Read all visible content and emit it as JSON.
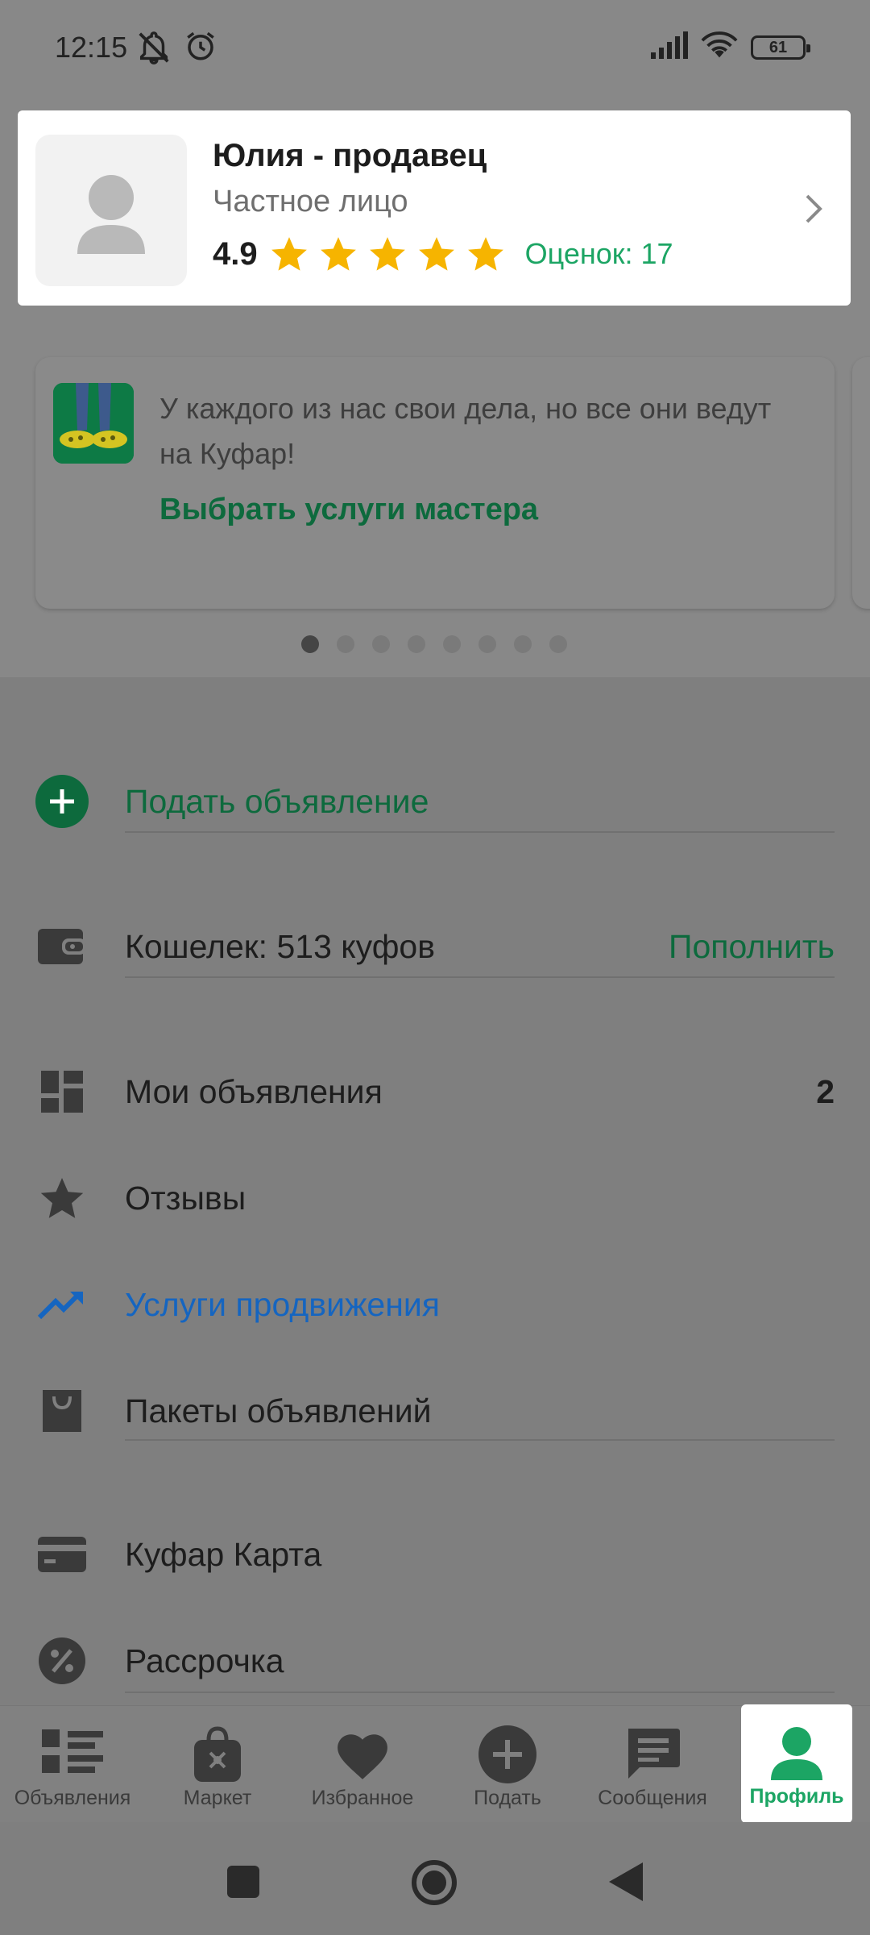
{
  "status_bar": {
    "time": "12:15",
    "battery": "61",
    "icons": [
      "notifications-off-icon",
      "alarm-icon",
      "signal-icon",
      "wifi-icon",
      "battery-icon"
    ]
  },
  "profile": {
    "name": "Юлия - продавец",
    "type": "Частное лицо",
    "rating": "4.9",
    "stars": 5,
    "ratings_count": "Оценок: 17"
  },
  "promo": {
    "text": "У каждого из нас свои дела, но все они ведут на Куфар!",
    "link": "Выбрать услуги мастера",
    "pages": 8,
    "active_page": 1
  },
  "menu": {
    "post_ad": "Подать объявление",
    "wallet": "Кошелек: 513 куфов",
    "wallet_action": "Пополнить",
    "my_ads": "Мои объявления",
    "my_ads_count": "2",
    "reviews": "Отзывы",
    "promotion": "Услуги продвижения",
    "packages": "Пакеты объявлений",
    "kufar_card": "Куфар Карта",
    "installment": "Рассрочка"
  },
  "bottom_nav": {
    "items": [
      {
        "label": "Объявления",
        "icon": "listings-icon"
      },
      {
        "label": "Маркет",
        "icon": "market-bag-icon"
      },
      {
        "label": "Избранное",
        "icon": "heart-icon"
      },
      {
        "label": "Подать",
        "icon": "plus-circle-icon"
      },
      {
        "label": "Сообщения",
        "icon": "chat-icon"
      },
      {
        "label": "Профиль",
        "icon": "profile-icon"
      }
    ],
    "active": "Профиль"
  },
  "colors": {
    "accent_green": "#1ca564",
    "dark_green": "#0d6a3d",
    "promo_blue": "#1565c0",
    "star_yellow": "#f6b400"
  }
}
